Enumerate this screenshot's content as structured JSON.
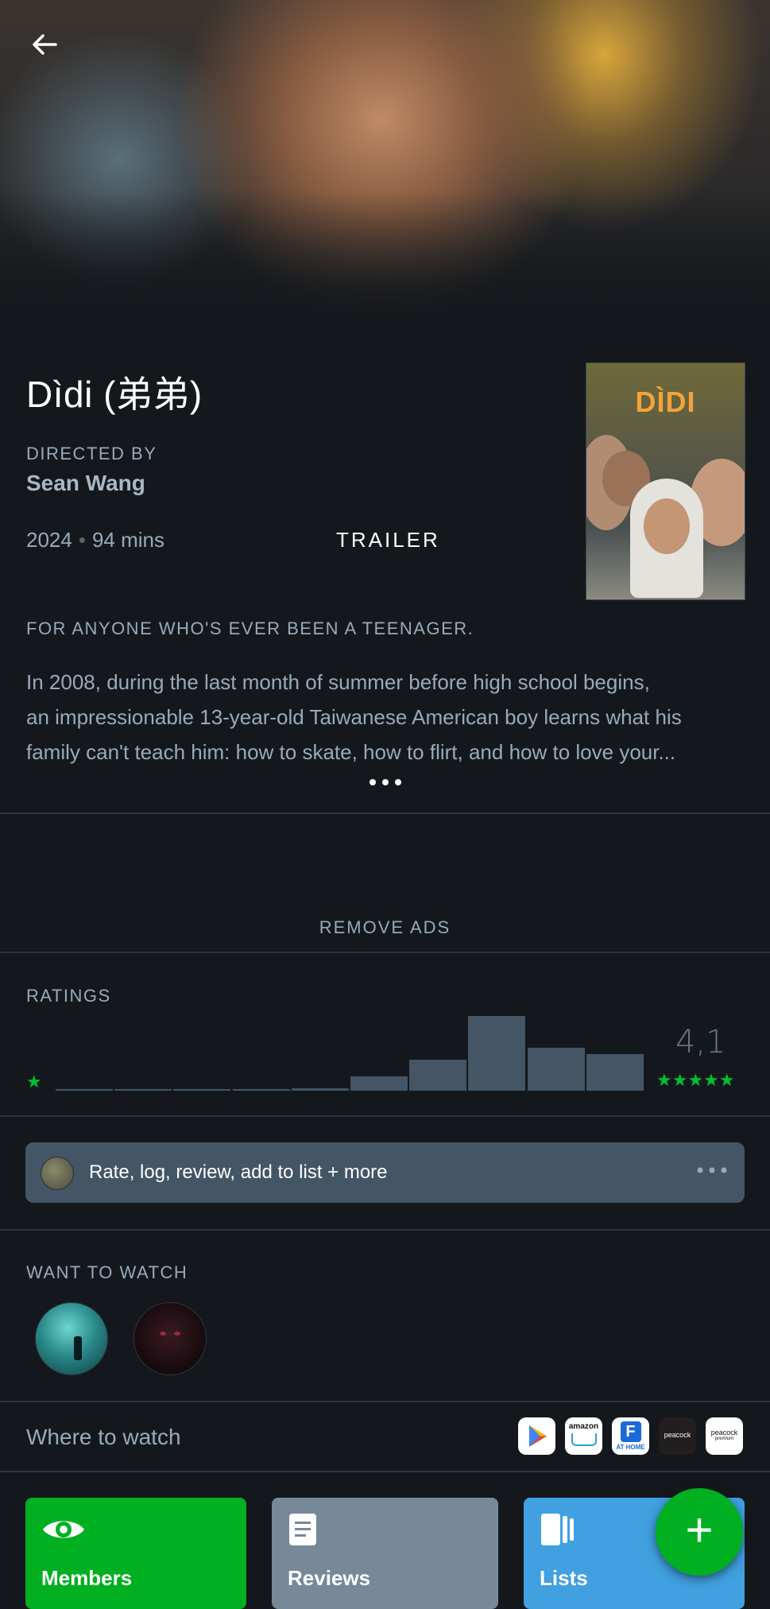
{
  "film": {
    "title": "Dìdi (弟弟)",
    "directed_by_label": "DIRECTED BY",
    "director": "Sean Wang",
    "year": "2024",
    "runtime": "94 mins",
    "trailer_label": "TRAILER",
    "poster_title": "DÌDI",
    "tagline": "FOR ANYONE WHO'S EVER BEEN A TEENAGER.",
    "synopsis_lines": [
      "In 2008, during the last month of summer before high school begins,",
      "an impressionable 13-year-old Taiwanese American boy learns what his",
      "family can't teach him: how to skate, how to flirt, and how to love your..."
    ]
  },
  "ads": {
    "remove_label": "REMOVE ADS"
  },
  "ratings": {
    "label": "RATINGS",
    "average": "4,1",
    "colors": {
      "bar": "#445566",
      "star": "#00c030"
    }
  },
  "chart_data": {
    "type": "bar",
    "categories": [
      "0.5",
      "1",
      "1.5",
      "2",
      "2.5",
      "3",
      "3.5",
      "4",
      "4.5",
      "5"
    ],
    "values": [
      1,
      1,
      1,
      1,
      2,
      14,
      31,
      75,
      43,
      37
    ],
    "title": "",
    "xlabel": "",
    "ylabel": ""
  },
  "action_bar": {
    "label": "Rate, log, review, add to list + more"
  },
  "want_to_watch": {
    "label": "WANT TO WATCH",
    "avatars": [
      "member-avatar-1",
      "member-avatar-2"
    ]
  },
  "where_to_watch": {
    "label": "Where to watch",
    "services": [
      "google-play",
      "amazon",
      "fandango-at-home",
      "peacock",
      "peacock-premium"
    ],
    "service_text": {
      "amazon": "amazon",
      "fandango": "AT HOME",
      "peacock": "peacock",
      "peacock_premium": "peacock"
    }
  },
  "tiles": {
    "members": {
      "label": "Members",
      "color": "#00b020"
    },
    "reviews": {
      "label": "Reviews",
      "color": "#778899"
    },
    "lists": {
      "label": "Lists",
      "color": "#40a0e0"
    }
  },
  "fab": {
    "label": "+"
  }
}
